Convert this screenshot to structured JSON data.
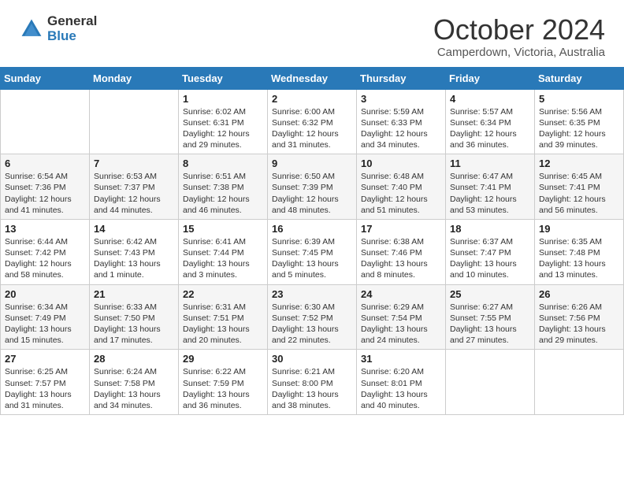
{
  "header": {
    "logo_general": "General",
    "logo_blue": "Blue",
    "title": "October 2024",
    "subtitle": "Camperdown, Victoria, Australia"
  },
  "weekdays": [
    "Sunday",
    "Monday",
    "Tuesday",
    "Wednesday",
    "Thursday",
    "Friday",
    "Saturday"
  ],
  "weeks": [
    [
      {
        "day": "",
        "info": ""
      },
      {
        "day": "",
        "info": ""
      },
      {
        "day": "1",
        "info": "Sunrise: 6:02 AM\nSunset: 6:31 PM\nDaylight: 12 hours and 29 minutes."
      },
      {
        "day": "2",
        "info": "Sunrise: 6:00 AM\nSunset: 6:32 PM\nDaylight: 12 hours and 31 minutes."
      },
      {
        "day": "3",
        "info": "Sunrise: 5:59 AM\nSunset: 6:33 PM\nDaylight: 12 hours and 34 minutes."
      },
      {
        "day": "4",
        "info": "Sunrise: 5:57 AM\nSunset: 6:34 PM\nDaylight: 12 hours and 36 minutes."
      },
      {
        "day": "5",
        "info": "Sunrise: 5:56 AM\nSunset: 6:35 PM\nDaylight: 12 hours and 39 minutes."
      }
    ],
    [
      {
        "day": "6",
        "info": "Sunrise: 6:54 AM\nSunset: 7:36 PM\nDaylight: 12 hours and 41 minutes."
      },
      {
        "day": "7",
        "info": "Sunrise: 6:53 AM\nSunset: 7:37 PM\nDaylight: 12 hours and 44 minutes."
      },
      {
        "day": "8",
        "info": "Sunrise: 6:51 AM\nSunset: 7:38 PM\nDaylight: 12 hours and 46 minutes."
      },
      {
        "day": "9",
        "info": "Sunrise: 6:50 AM\nSunset: 7:39 PM\nDaylight: 12 hours and 48 minutes."
      },
      {
        "day": "10",
        "info": "Sunrise: 6:48 AM\nSunset: 7:40 PM\nDaylight: 12 hours and 51 minutes."
      },
      {
        "day": "11",
        "info": "Sunrise: 6:47 AM\nSunset: 7:41 PM\nDaylight: 12 hours and 53 minutes."
      },
      {
        "day": "12",
        "info": "Sunrise: 6:45 AM\nSunset: 7:41 PM\nDaylight: 12 hours and 56 minutes."
      }
    ],
    [
      {
        "day": "13",
        "info": "Sunrise: 6:44 AM\nSunset: 7:42 PM\nDaylight: 12 hours and 58 minutes."
      },
      {
        "day": "14",
        "info": "Sunrise: 6:42 AM\nSunset: 7:43 PM\nDaylight: 13 hours and 1 minute."
      },
      {
        "day": "15",
        "info": "Sunrise: 6:41 AM\nSunset: 7:44 PM\nDaylight: 13 hours and 3 minutes."
      },
      {
        "day": "16",
        "info": "Sunrise: 6:39 AM\nSunset: 7:45 PM\nDaylight: 13 hours and 5 minutes."
      },
      {
        "day": "17",
        "info": "Sunrise: 6:38 AM\nSunset: 7:46 PM\nDaylight: 13 hours and 8 minutes."
      },
      {
        "day": "18",
        "info": "Sunrise: 6:37 AM\nSunset: 7:47 PM\nDaylight: 13 hours and 10 minutes."
      },
      {
        "day": "19",
        "info": "Sunrise: 6:35 AM\nSunset: 7:48 PM\nDaylight: 13 hours and 13 minutes."
      }
    ],
    [
      {
        "day": "20",
        "info": "Sunrise: 6:34 AM\nSunset: 7:49 PM\nDaylight: 13 hours and 15 minutes."
      },
      {
        "day": "21",
        "info": "Sunrise: 6:33 AM\nSunset: 7:50 PM\nDaylight: 13 hours and 17 minutes."
      },
      {
        "day": "22",
        "info": "Sunrise: 6:31 AM\nSunset: 7:51 PM\nDaylight: 13 hours and 20 minutes."
      },
      {
        "day": "23",
        "info": "Sunrise: 6:30 AM\nSunset: 7:52 PM\nDaylight: 13 hours and 22 minutes."
      },
      {
        "day": "24",
        "info": "Sunrise: 6:29 AM\nSunset: 7:54 PM\nDaylight: 13 hours and 24 minutes."
      },
      {
        "day": "25",
        "info": "Sunrise: 6:27 AM\nSunset: 7:55 PM\nDaylight: 13 hours and 27 minutes."
      },
      {
        "day": "26",
        "info": "Sunrise: 6:26 AM\nSunset: 7:56 PM\nDaylight: 13 hours and 29 minutes."
      }
    ],
    [
      {
        "day": "27",
        "info": "Sunrise: 6:25 AM\nSunset: 7:57 PM\nDaylight: 13 hours and 31 minutes."
      },
      {
        "day": "28",
        "info": "Sunrise: 6:24 AM\nSunset: 7:58 PM\nDaylight: 13 hours and 34 minutes."
      },
      {
        "day": "29",
        "info": "Sunrise: 6:22 AM\nSunset: 7:59 PM\nDaylight: 13 hours and 36 minutes."
      },
      {
        "day": "30",
        "info": "Sunrise: 6:21 AM\nSunset: 8:00 PM\nDaylight: 13 hours and 38 minutes."
      },
      {
        "day": "31",
        "info": "Sunrise: 6:20 AM\nSunset: 8:01 PM\nDaylight: 13 hours and 40 minutes."
      },
      {
        "day": "",
        "info": ""
      },
      {
        "day": "",
        "info": ""
      }
    ]
  ]
}
